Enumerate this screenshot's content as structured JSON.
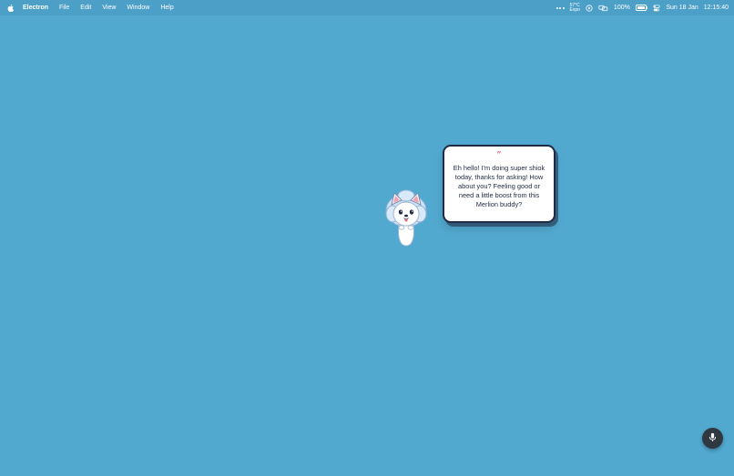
{
  "menubar": {
    "app_name": "Electron",
    "items": [
      "File",
      "Edit",
      "View",
      "Window",
      "Help"
    ],
    "weather_temp": "57°C",
    "weather_sub": "Expo",
    "battery_percent": "100%",
    "battery_level": 1.0,
    "date": "Sun 18 Jan",
    "time": "12:15:40"
  },
  "bubble": {
    "quote_mark": "”",
    "text": "Eh hello! I'm doing super shiok today, thanks for asking! How about you? Feeling good or need a little boost from this Merlion buddy?"
  },
  "icons": {
    "apple": "apple-icon",
    "more": "more-dots-icon",
    "screen_record": "screen-record-icon",
    "link": "link-icon",
    "battery": "battery-icon",
    "control_center": "control-center-icon",
    "mic": "microphone-icon"
  },
  "colors": {
    "desktop": "#52a9d0",
    "menubar": "#4c9fc6",
    "bubble_border": "#1f2a44",
    "quote_accent": "#e0607a",
    "mic_button": "#2f3740"
  }
}
